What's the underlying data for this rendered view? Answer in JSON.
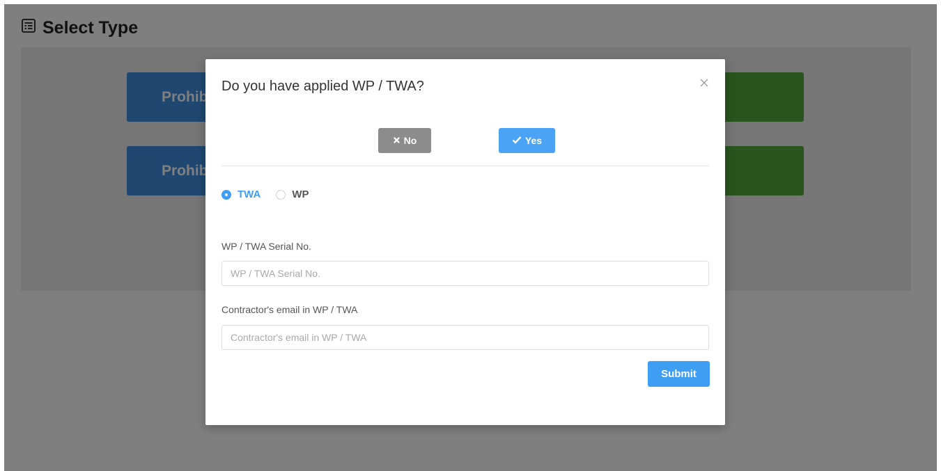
{
  "page": {
    "title": "Select Type",
    "title_icon": "form-icon",
    "type_buttons": [
      {
        "label": "Prohib",
        "color": "#3f8ee0"
      },
      {
        "label": "Prohib",
        "color": "#3f8ee0"
      },
      {
        "label": "",
        "color": "#52a83a"
      },
      {
        "label": "",
        "color": "#52a83a"
      }
    ]
  },
  "modal": {
    "title": "Do you have applied WP / TWA?",
    "close_icon": "close-icon",
    "no_label": "No",
    "yes_label": "Yes",
    "radio_options": [
      {
        "label": "TWA",
        "checked": true
      },
      {
        "label": "WP",
        "checked": false
      }
    ],
    "serial_label": "WP / TWA Serial No.",
    "serial_placeholder": "WP / TWA Serial No.",
    "email_label": "Contractor's email in WP / TWA",
    "email_placeholder": "Contractor's email in WP / TWA",
    "submit_label": "Submit"
  },
  "colors": {
    "primary": "#3e9ef3",
    "muted_button": "#8c8c8c",
    "blue_type": "#3f8ee0",
    "green_type": "#52a83a"
  }
}
